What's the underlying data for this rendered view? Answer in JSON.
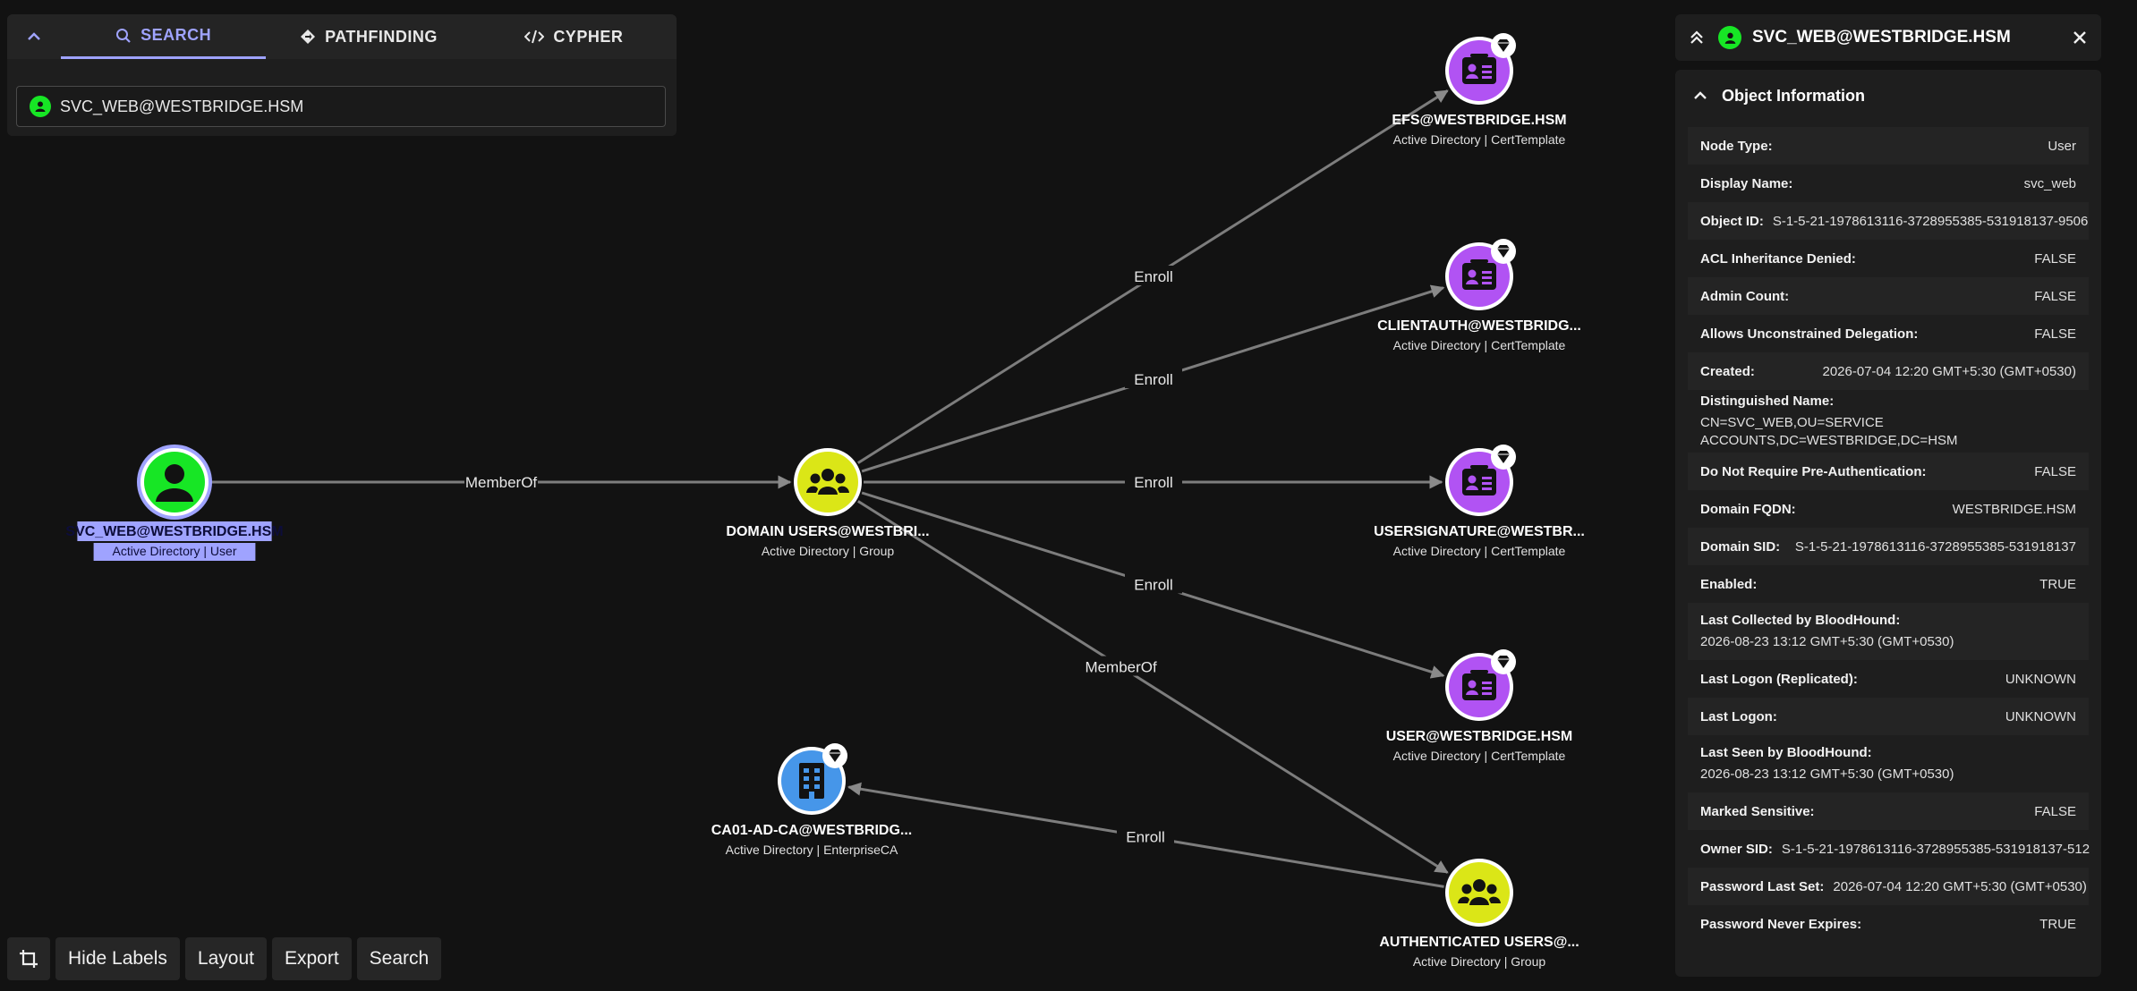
{
  "search_panel": {
    "tabs": [
      {
        "label": "SEARCH",
        "icon": "search-icon"
      },
      {
        "label": "PATHFINDING",
        "icon": "diamond-route-icon"
      },
      {
        "label": "CYPHER",
        "icon": "code-icon"
      }
    ],
    "active_tab": "SEARCH",
    "search_value": "SVC_WEB@WESTBRIDGE.HSM"
  },
  "graph": {
    "nodes": [
      {
        "id": "svc",
        "name": "SVC_WEB@WESTBRIDGE.HSM",
        "sub": "Active Directory | User",
        "kind": "user",
        "color": "#17e625",
        "selected": true
      },
      {
        "id": "du",
        "name": "DOMAIN USERS@WESTBRI...",
        "sub": "Active Directory | Group",
        "kind": "group",
        "color": "#dbe617"
      },
      {
        "id": "efs",
        "name": "EFS@WESTBRIDGE.HSM",
        "sub": "Active Directory | CertTemplate",
        "kind": "cert",
        "color": "#b153f3"
      },
      {
        "id": "ca",
        "name": "CLIENTAUTH@WESTBRIDG...",
        "sub": "Active Directory | CertTemplate",
        "kind": "cert",
        "color": "#b153f3"
      },
      {
        "id": "us",
        "name": "USERSIGNATURE@WESTBR...",
        "sub": "Active Directory | CertTemplate",
        "kind": "cert",
        "color": "#b153f3"
      },
      {
        "id": "user",
        "name": "USER@WESTBRIDGE.HSM",
        "sub": "Active Directory | CertTemplate",
        "kind": "cert",
        "color": "#b153f3"
      },
      {
        "id": "au",
        "name": "AUTHENTICATED USERS@...",
        "sub": "Active Directory | Group",
        "kind": "group",
        "color": "#dbe617"
      },
      {
        "id": "ent",
        "name": "CA01-AD-CA@WESTBRIDG...",
        "sub": "Active Directory | EnterpriseCA",
        "kind": "enterprise",
        "color": "#4696e9"
      }
    ],
    "edges": [
      {
        "from": "svc",
        "to": "du",
        "label": "MemberOf"
      },
      {
        "from": "du",
        "to": "efs",
        "label": "Enroll"
      },
      {
        "from": "du",
        "to": "ca",
        "label": "Enroll"
      },
      {
        "from": "du",
        "to": "us",
        "label": "Enroll"
      },
      {
        "from": "du",
        "to": "user",
        "label": "Enroll"
      },
      {
        "from": "du",
        "to": "au",
        "label": "MemberOf"
      },
      {
        "from": "au",
        "to": "ent",
        "label": "Enroll"
      }
    ]
  },
  "toolbar": {
    "crop_icon": "crop-icon",
    "hide_labels": "Hide Labels",
    "layout": "Layout",
    "export": "Export",
    "search": "Search"
  },
  "entity_panel": {
    "title": "SVC_WEB@WESTBRIDGE.HSM",
    "section_title": "Object Information",
    "properties": [
      {
        "key": "Node Type:",
        "value": "User"
      },
      {
        "key": "Display Name:",
        "value": "svc_web"
      },
      {
        "key": "Object ID:",
        "value": "S-1-5-21-1978613116-3728955385-531918137-9506"
      },
      {
        "key": "ACL Inheritance Denied:",
        "value": "FALSE"
      },
      {
        "key": "Admin Count:",
        "value": "FALSE"
      },
      {
        "key": "Allows Unconstrained Delegation:",
        "value": "FALSE"
      },
      {
        "key": "Created:",
        "value": "2026-07-04 12:20 GMT+5:30 (GMT+0530)"
      },
      {
        "key": "Distinguished Name:",
        "value": "CN=SVC_WEB,OU=SERVICE ACCOUNTS,DC=WESTBRIDGE,DC=HSM",
        "stack": true
      },
      {
        "key": "Do Not Require Pre-Authentication:",
        "value": "FALSE"
      },
      {
        "key": "Domain FQDN:",
        "value": "WESTBRIDGE.HSM"
      },
      {
        "key": "Domain SID:",
        "value": "S-1-5-21-1978613116-3728955385-531918137"
      },
      {
        "key": "Enabled:",
        "value": "TRUE"
      },
      {
        "key": "Last Collected by BloodHound:",
        "value": "2026-08-23 13:12 GMT+5:30 (GMT+0530)",
        "stack": true
      },
      {
        "key": "Last Logon (Replicated):",
        "value": "UNKNOWN"
      },
      {
        "key": "Last Logon:",
        "value": "UNKNOWN"
      },
      {
        "key": "Last Seen by BloodHound:",
        "value": "2026-08-23 13:12 GMT+5:30 (GMT+0530)",
        "stack": true
      },
      {
        "key": "Marked Sensitive:",
        "value": "FALSE"
      },
      {
        "key": "Owner SID:",
        "value": "S-1-5-21-1978613116-3728955385-531918137-512"
      },
      {
        "key": "Password Last Set:",
        "value": "2026-07-04 12:20 GMT+5:30 (GMT+0530)"
      },
      {
        "key": "Password Never Expires:",
        "value": "TRUE"
      }
    ]
  }
}
